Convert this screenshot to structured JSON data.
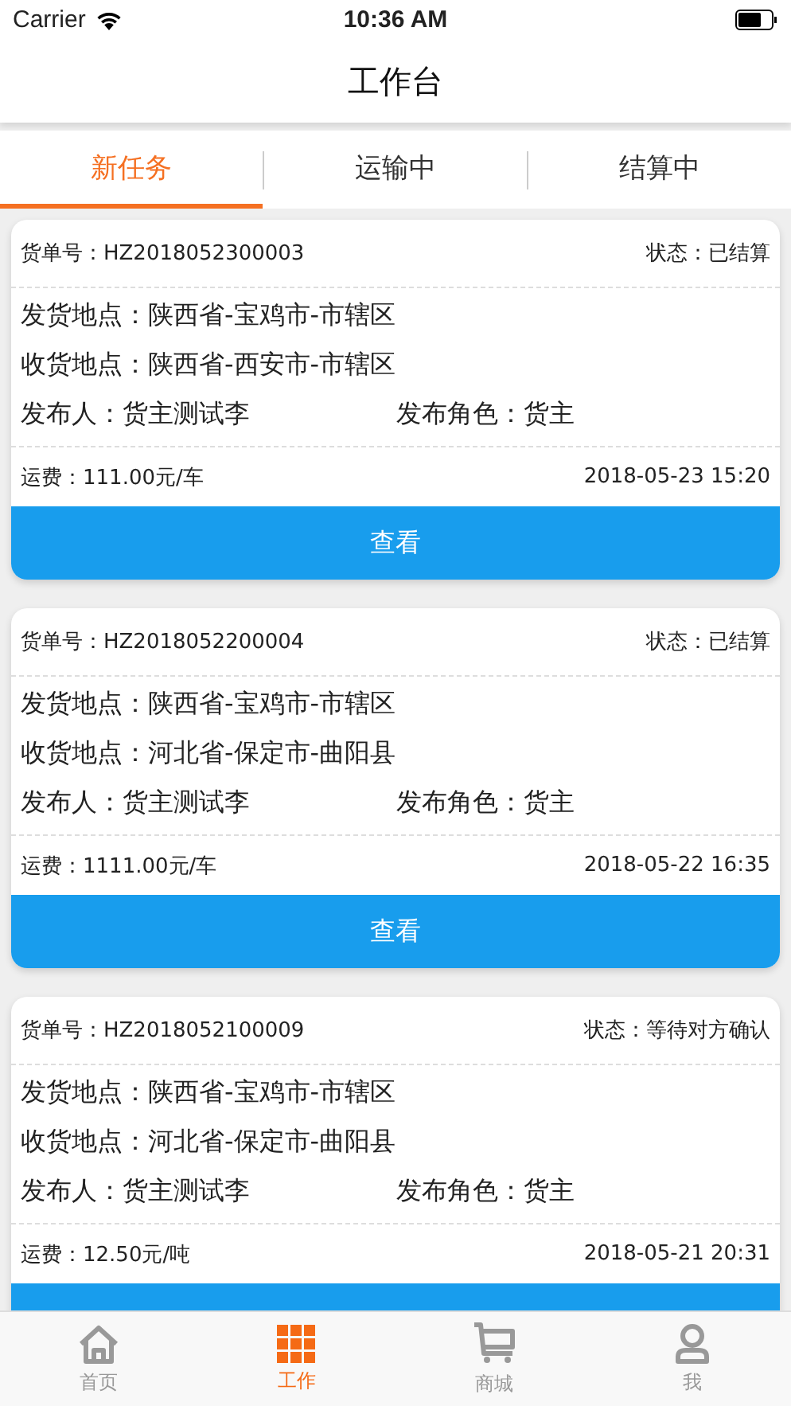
{
  "status_bar": {
    "carrier": "Carrier",
    "time": "10:36 AM"
  },
  "header": {
    "title": "工作台"
  },
  "tabs": [
    {
      "label": "新任务",
      "selected": true
    },
    {
      "label": "运输中",
      "selected": false
    },
    {
      "label": "结算中",
      "selected": false
    }
  ],
  "orders": [
    {
      "order_no_label": "货单号：",
      "order_no": "HZ2018052300003",
      "status_label": "状态：",
      "status": "已结算",
      "from_label": "发货地点：",
      "from": "陕西省-宝鸡市-市辖区",
      "to_label": "收货地点：",
      "to": "陕西省-西安市-市辖区",
      "publisher_label": "发布人：",
      "publisher": "货主测试李",
      "role_label": "发布角色：",
      "role": "货主",
      "fee_label": "运费：",
      "fee": "111.00元/车",
      "time": "2018-05-23 15:20",
      "action": "查看"
    },
    {
      "order_no_label": "货单号：",
      "order_no": "HZ2018052200004",
      "status_label": "状态：",
      "status": "已结算",
      "from_label": "发货地点：",
      "from": "陕西省-宝鸡市-市辖区",
      "to_label": "收货地点：",
      "to": "河北省-保定市-曲阳县",
      "publisher_label": "发布人：",
      "publisher": "货主测试李",
      "role_label": "发布角色：",
      "role": "货主",
      "fee_label": "运费：",
      "fee": "1111.00元/车",
      "time": "2018-05-22 16:35",
      "action": "查看"
    },
    {
      "order_no_label": "货单号：",
      "order_no": "HZ2018052100009",
      "status_label": "状态：",
      "status": "等待对方确认",
      "from_label": "发货地点：",
      "from": "陕西省-宝鸡市-市辖区",
      "to_label": "收货地点：",
      "to": "河北省-保定市-曲阳县",
      "publisher_label": "发布人：",
      "publisher": "货主测试李",
      "role_label": "发布角色：",
      "role": "货主",
      "fee_label": "运费：",
      "fee": "12.50元/吨",
      "time": "2018-05-21 20:31"
    }
  ],
  "tab_bar": [
    {
      "kind": "home",
      "label": "首页",
      "selected": false
    },
    {
      "kind": "grid",
      "label": "工作",
      "selected": true
    },
    {
      "kind": "cart",
      "label": "商城",
      "selected": false
    },
    {
      "kind": "user",
      "label": "我",
      "selected": false
    }
  ]
}
